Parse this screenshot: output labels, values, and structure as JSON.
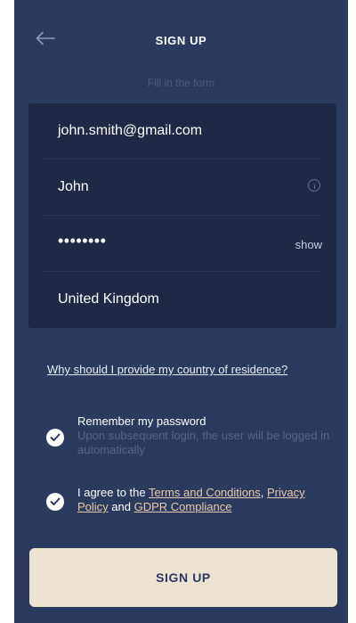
{
  "header": {
    "title": "SIGN UP",
    "subtitle": "Fill in the form",
    "back_icon": "arrow-left-icon"
  },
  "form": {
    "email": "john.smith@gmail.com",
    "name": "John",
    "name_info_icon": "info-icon",
    "password_masked": "••••••••",
    "password_toggle_label": "show",
    "country": "United Kingdom"
  },
  "country_help_link": "Why should I provide my country of residence?",
  "remember_password": {
    "label": "Remember my password",
    "hint": "Upon subsequent login, the user will be logged in automatically",
    "checked": true
  },
  "agreement": {
    "prefix": "I agree to the ",
    "terms_link": "Terms and Conditions",
    "separator": ", ",
    "privacy_link": "Privacy Policy",
    "conjunction": " and ",
    "gdpr_link": "GDPR Compliance",
    "checked": true
  },
  "submit_label": "SIGN UP",
  "colors": {
    "background": "#2d3a5f",
    "card": "#1f2947",
    "accent": "#e7c9a7",
    "button": "#ede3d3"
  }
}
